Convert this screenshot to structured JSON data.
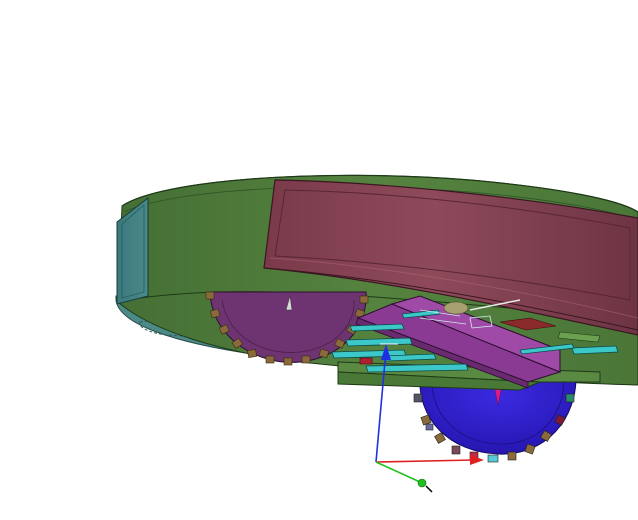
{
  "viewport": {
    "background": "#ffffff",
    "content": "3d-cad-model"
  },
  "colors": {
    "housing_green": "#4e7a3c",
    "housing_green_dark": "#3d6530",
    "housing_teal": "#3d8080",
    "panel_maroon": "#8a4655",
    "panel_maroon_dark": "#6b3443",
    "gear_purple": "#6d3470",
    "gear_blue": "#2f1fcf",
    "gear_teeth": "#8a6a3a",
    "rails_cyan": "#39c6c6",
    "axis_x": "#e02020",
    "axis_y": "#20c020",
    "axis_z": "#2030e0"
  },
  "icons": {
    "axis_triad": "xyz-axis-triad-icon"
  }
}
